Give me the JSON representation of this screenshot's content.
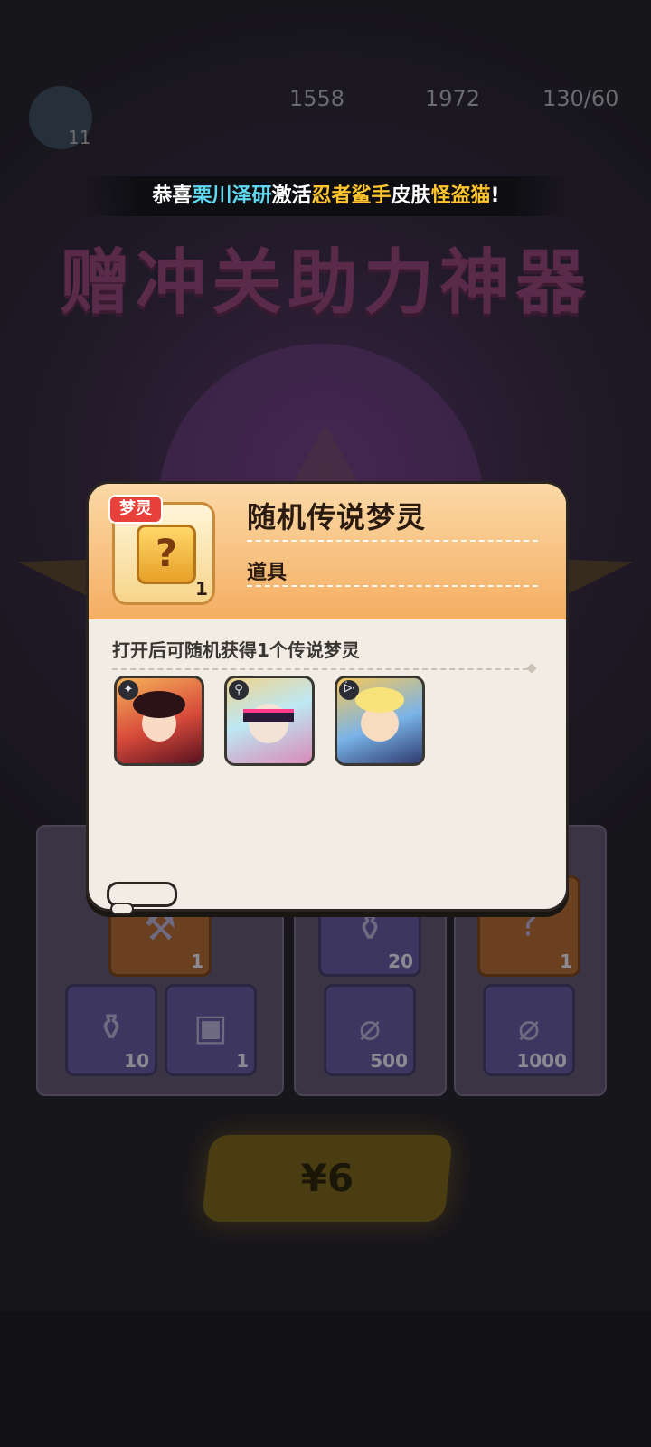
{
  "status_bar": {
    "level": "11",
    "stat1": "1558",
    "stat2": "1972",
    "stat3": "130/60"
  },
  "banner": {
    "prefix": "恭喜",
    "player": "栗川泽研",
    "middle": "激活",
    "character": "忍者鲨手",
    "skin_word": "皮肤",
    "skin": "怪盗猫",
    "suffix": "!"
  },
  "background": {
    "title": "赠冲关助力神器",
    "price": "¥6",
    "slot_counts": [
      "1",
      "20",
      "1",
      "10",
      "1",
      "500",
      "1000"
    ]
  },
  "popup": {
    "item_tag": "梦灵",
    "item_count": "1",
    "item_name": "随机传说梦灵",
    "item_type": "道具",
    "description": "打开后可随机获得1个传说梦灵",
    "rewards": [
      {
        "name": "legend-spirit-red",
        "badge_icon": "leaf-icon"
      },
      {
        "name": "legend-spirit-cyber",
        "badge_icon": "bulb-icon"
      },
      {
        "name": "legend-spirit-blonde",
        "badge_icon": "rabbit-icon"
      }
    ]
  },
  "colors": {
    "popup_bg": "#f2ede4",
    "popup_header": "#f4ae62",
    "banner_cyan": "#5fd8f0",
    "banner_gold": "#ffc52e",
    "tag_red": "#e8413b"
  }
}
